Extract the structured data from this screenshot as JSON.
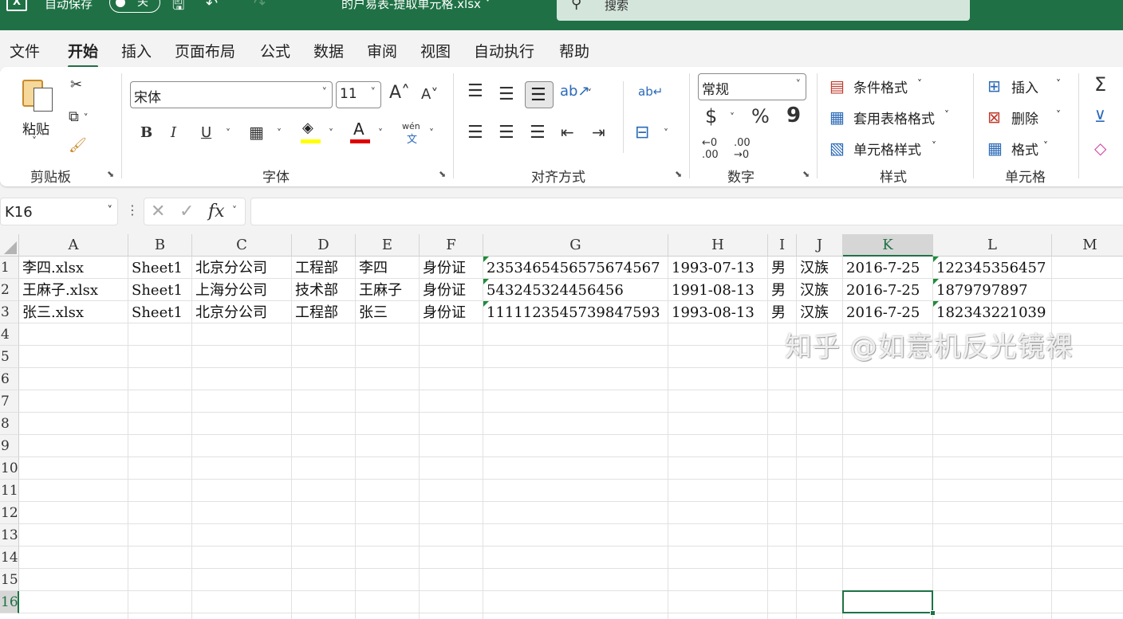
{
  "titlebar": {
    "autosave_label": "自动保存",
    "autosave_state": "关",
    "filename": "的户易表-提取单元格.xlsx",
    "search_placeholder": "搜索"
  },
  "menu": {
    "tabs": [
      "文件",
      "开始",
      "插入",
      "页面布局",
      "公式",
      "数据",
      "审阅",
      "视图",
      "自动执行",
      "帮助"
    ],
    "active_tab": "开始"
  },
  "ribbon": {
    "clipboard": {
      "paste_label": "粘贴",
      "group_label": "剪贴板"
    },
    "font": {
      "font_name": "宋体",
      "font_size": "11",
      "bold": "B",
      "italic": "I",
      "underline": "U",
      "font_color_glyph": "A",
      "phonetic_top": "wén",
      "phonetic_bottom": "文",
      "group_label": "字体",
      "fill_color": "#ffff00",
      "font_color": "#e00000"
    },
    "alignment": {
      "group_label": "对齐方式"
    },
    "number": {
      "format": "常规",
      "currency": "$",
      "percent": "%",
      "comma": "9",
      "group_label": "数字"
    },
    "styles": {
      "conditional": "条件格式",
      "table": "套用表格格式",
      "cell_style": "单元格样式",
      "group_label": "样式"
    },
    "cells": {
      "insert": "插入",
      "delete": "删除",
      "format": "格式",
      "group_label": "单元格"
    }
  },
  "formula_bar": {
    "name_box": "K16",
    "fx": "fx",
    "content": ""
  },
  "grid": {
    "columns": [
      "A",
      "B",
      "C",
      "D",
      "E",
      "F",
      "G",
      "H",
      "I",
      "J",
      "K",
      "L",
      "M"
    ],
    "selected_column": "K",
    "rows": [
      "1",
      "2",
      "3",
      "4",
      "5",
      "6",
      "7",
      "8",
      "9",
      "10",
      "11",
      "12",
      "13",
      "14",
      "15",
      "16"
    ],
    "selected_row": "16",
    "data": [
      [
        "李四.xlsx",
        "Sheet1",
        "北京分公司",
        "工程部",
        "李四",
        "身份证",
        "2353465456575674567",
        "1993-07-13",
        "男",
        "汉族",
        "2016-7-25",
        "122345356457"
      ],
      [
        "王麻子.xlsx",
        "Sheet1",
        "上海分公司",
        "技术部",
        "王麻子",
        "身份证",
        "543245324456456",
        "1991-08-13",
        "男",
        "汉族",
        "2016-7-25",
        "1879797897"
      ],
      [
        "张三.xlsx",
        "Sheet1",
        "北京分公司",
        "工程部",
        "张三",
        "身份证",
        "1111123545739847593",
        "1993-08-13",
        "男",
        "汉族",
        "2016-7-25",
        "182343221039"
      ]
    ]
  },
  "watermark": "知乎 @如意机反光镜裸"
}
